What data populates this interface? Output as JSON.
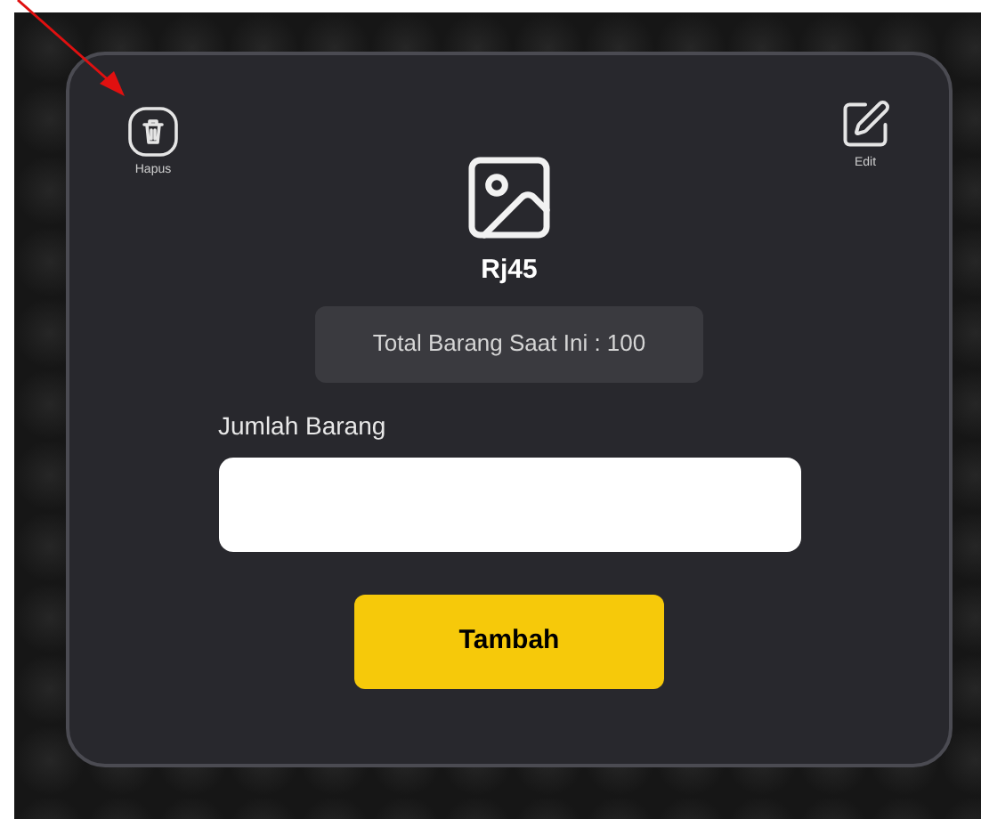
{
  "actions": [
    {
      "kind": "delete",
      "label": "Hapus"
    },
    {
      "kind": "edit",
      "label": "Edit"
    }
  ],
  "item": {
    "name": "Rj45",
    "total": "Total Barang Saat Ini : 100"
  },
  "form": {
    "label": "Jumlah Barang",
    "submit": "Tambah"
  }
}
